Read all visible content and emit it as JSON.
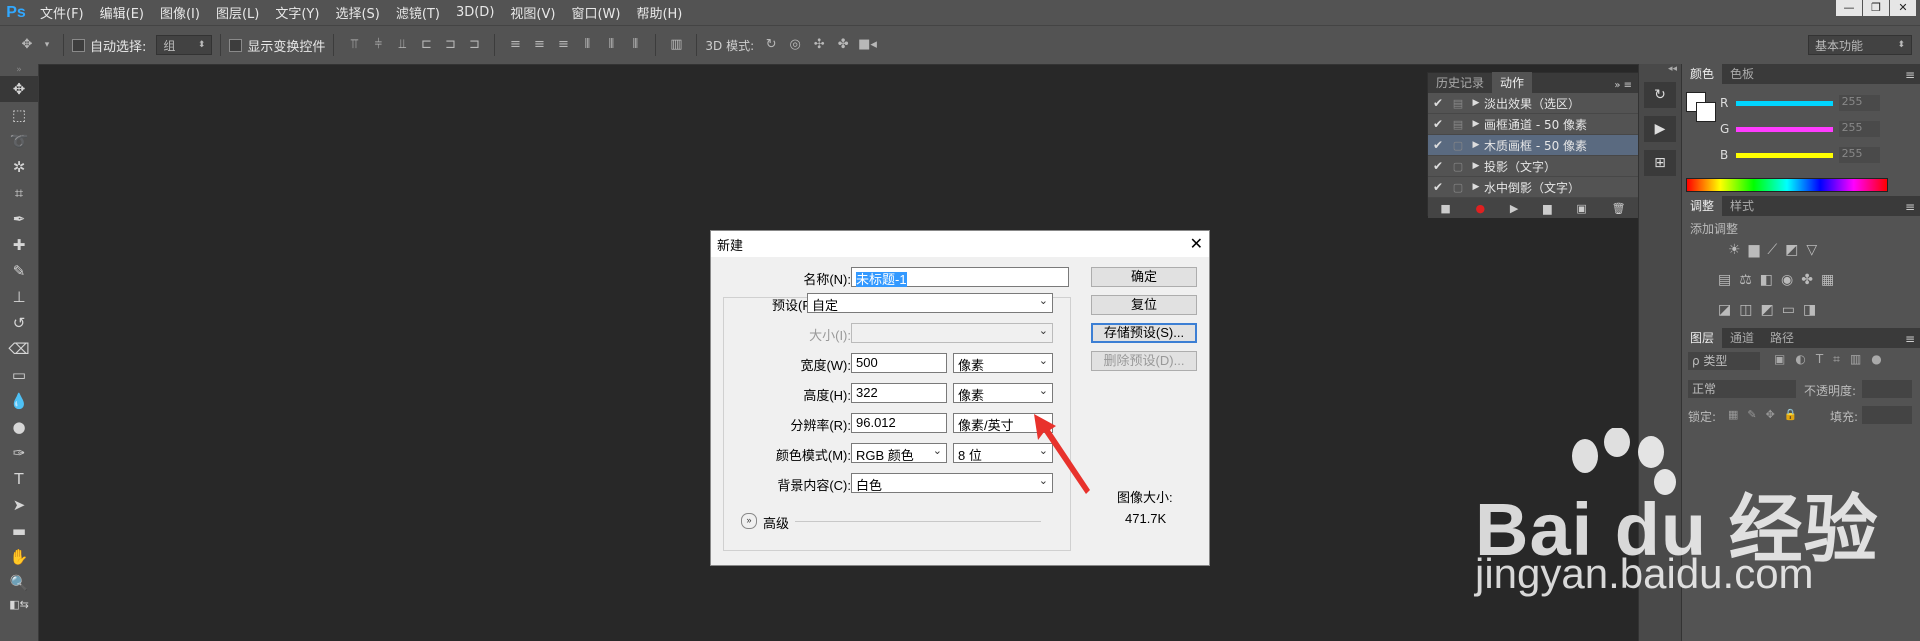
{
  "app": {
    "logo": "Ps"
  },
  "menu": [
    "文件(F)",
    "编辑(E)",
    "图像(I)",
    "图层(L)",
    "文字(Y)",
    "选择(S)",
    "滤镜(T)",
    "3D(D)",
    "视图(V)",
    "窗口(W)",
    "帮助(H)"
  ],
  "window_controls": [
    "—",
    "❐",
    "✕"
  ],
  "options_bar": {
    "auto_select_label": "自动选择:",
    "auto_select_value": "组",
    "show_transform_label": "显示变换控件",
    "mode_3d_label": "3D 模式:",
    "workspace": "基本功能"
  },
  "actions_panel": {
    "tabs": [
      "历史记录",
      "动作"
    ],
    "rows": [
      {
        "label": "淡出效果（选区）",
        "selected": false
      },
      {
        "label": "画框通道 - 50 像素",
        "selected": false
      },
      {
        "label": "木质画框 - 50 像素",
        "selected": true
      },
      {
        "label": "投影（文字）",
        "selected": false
      },
      {
        "label": "水中倒影（文字）",
        "selected": false
      }
    ]
  },
  "color_panel": {
    "tabs": [
      "颜色",
      "色板"
    ],
    "channels": [
      {
        "name": "R",
        "value": "255",
        "color": "#00d5ff"
      },
      {
        "name": "G",
        "value": "255",
        "color": "#ff3cff"
      },
      {
        "name": "B",
        "value": "255",
        "color": "#ffff00"
      }
    ]
  },
  "adjust_panel": {
    "tabs": [
      "调整",
      "样式"
    ],
    "add_label": "添加调整"
  },
  "layers_panel": {
    "tabs": [
      "图层",
      "通道",
      "路径"
    ],
    "filter_type": "ρ 类型",
    "blend_mode": "正常",
    "opacity_label": "不透明度:",
    "lock_label": "锁定:",
    "fill_label": "填充:"
  },
  "dialog": {
    "title": "新建",
    "name_label": "名称(N):",
    "name_value": "未标题-1",
    "preset_label": "预设(P):",
    "preset_value": "自定",
    "size_label": "大小(I):",
    "width_label": "宽度(W):",
    "width_value": "500",
    "width_unit": "像素",
    "height_label": "高度(H):",
    "height_value": "322",
    "height_unit": "像素",
    "resolution_label": "分辨率(R):",
    "resolution_value": "96.012",
    "resolution_unit": "像素/英寸",
    "color_mode_label": "颜色模式(M):",
    "color_mode_value": "RGB 颜色",
    "bit_depth": "8 位",
    "background_label": "背景内容(C):",
    "background_value": "白色",
    "advanced_label": "高级",
    "buttons": {
      "ok": "确定",
      "reset": "复位",
      "save_preset": "存储预设(S)...",
      "delete_preset": "删除预设(D)..."
    },
    "image_size_label": "图像大小:",
    "image_size_value": "471.7K"
  },
  "watermark": {
    "brand": "Bai du 经验",
    "url": "jingyan.baidu.com"
  }
}
